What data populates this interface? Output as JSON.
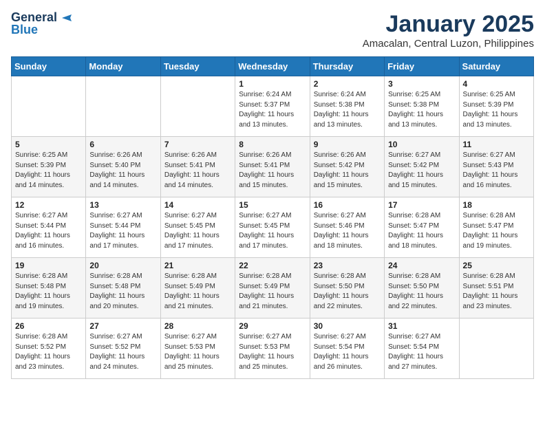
{
  "header": {
    "logo_line1": "General",
    "logo_line2": "Blue",
    "month_title": "January 2025",
    "location": "Amacalan, Central Luzon, Philippines"
  },
  "days_of_week": [
    "Sunday",
    "Monday",
    "Tuesday",
    "Wednesday",
    "Thursday",
    "Friday",
    "Saturday"
  ],
  "weeks": [
    [
      {
        "num": "",
        "info": ""
      },
      {
        "num": "",
        "info": ""
      },
      {
        "num": "",
        "info": ""
      },
      {
        "num": "1",
        "info": "Sunrise: 6:24 AM\nSunset: 5:37 PM\nDaylight: 11 hours\nand 13 minutes."
      },
      {
        "num": "2",
        "info": "Sunrise: 6:24 AM\nSunset: 5:38 PM\nDaylight: 11 hours\nand 13 minutes."
      },
      {
        "num": "3",
        "info": "Sunrise: 6:25 AM\nSunset: 5:38 PM\nDaylight: 11 hours\nand 13 minutes."
      },
      {
        "num": "4",
        "info": "Sunrise: 6:25 AM\nSunset: 5:39 PM\nDaylight: 11 hours\nand 13 minutes."
      }
    ],
    [
      {
        "num": "5",
        "info": "Sunrise: 6:25 AM\nSunset: 5:39 PM\nDaylight: 11 hours\nand 14 minutes."
      },
      {
        "num": "6",
        "info": "Sunrise: 6:26 AM\nSunset: 5:40 PM\nDaylight: 11 hours\nand 14 minutes."
      },
      {
        "num": "7",
        "info": "Sunrise: 6:26 AM\nSunset: 5:41 PM\nDaylight: 11 hours\nand 14 minutes."
      },
      {
        "num": "8",
        "info": "Sunrise: 6:26 AM\nSunset: 5:41 PM\nDaylight: 11 hours\nand 15 minutes."
      },
      {
        "num": "9",
        "info": "Sunrise: 6:26 AM\nSunset: 5:42 PM\nDaylight: 11 hours\nand 15 minutes."
      },
      {
        "num": "10",
        "info": "Sunrise: 6:27 AM\nSunset: 5:42 PM\nDaylight: 11 hours\nand 15 minutes."
      },
      {
        "num": "11",
        "info": "Sunrise: 6:27 AM\nSunset: 5:43 PM\nDaylight: 11 hours\nand 16 minutes."
      }
    ],
    [
      {
        "num": "12",
        "info": "Sunrise: 6:27 AM\nSunset: 5:44 PM\nDaylight: 11 hours\nand 16 minutes."
      },
      {
        "num": "13",
        "info": "Sunrise: 6:27 AM\nSunset: 5:44 PM\nDaylight: 11 hours\nand 17 minutes."
      },
      {
        "num": "14",
        "info": "Sunrise: 6:27 AM\nSunset: 5:45 PM\nDaylight: 11 hours\nand 17 minutes."
      },
      {
        "num": "15",
        "info": "Sunrise: 6:27 AM\nSunset: 5:45 PM\nDaylight: 11 hours\nand 17 minutes."
      },
      {
        "num": "16",
        "info": "Sunrise: 6:27 AM\nSunset: 5:46 PM\nDaylight: 11 hours\nand 18 minutes."
      },
      {
        "num": "17",
        "info": "Sunrise: 6:28 AM\nSunset: 5:47 PM\nDaylight: 11 hours\nand 18 minutes."
      },
      {
        "num": "18",
        "info": "Sunrise: 6:28 AM\nSunset: 5:47 PM\nDaylight: 11 hours\nand 19 minutes."
      }
    ],
    [
      {
        "num": "19",
        "info": "Sunrise: 6:28 AM\nSunset: 5:48 PM\nDaylight: 11 hours\nand 19 minutes."
      },
      {
        "num": "20",
        "info": "Sunrise: 6:28 AM\nSunset: 5:48 PM\nDaylight: 11 hours\nand 20 minutes."
      },
      {
        "num": "21",
        "info": "Sunrise: 6:28 AM\nSunset: 5:49 PM\nDaylight: 11 hours\nand 21 minutes."
      },
      {
        "num": "22",
        "info": "Sunrise: 6:28 AM\nSunset: 5:49 PM\nDaylight: 11 hours\nand 21 minutes."
      },
      {
        "num": "23",
        "info": "Sunrise: 6:28 AM\nSunset: 5:50 PM\nDaylight: 11 hours\nand 22 minutes."
      },
      {
        "num": "24",
        "info": "Sunrise: 6:28 AM\nSunset: 5:50 PM\nDaylight: 11 hours\nand 22 minutes."
      },
      {
        "num": "25",
        "info": "Sunrise: 6:28 AM\nSunset: 5:51 PM\nDaylight: 11 hours\nand 23 minutes."
      }
    ],
    [
      {
        "num": "26",
        "info": "Sunrise: 6:28 AM\nSunset: 5:52 PM\nDaylight: 11 hours\nand 23 minutes."
      },
      {
        "num": "27",
        "info": "Sunrise: 6:27 AM\nSunset: 5:52 PM\nDaylight: 11 hours\nand 24 minutes."
      },
      {
        "num": "28",
        "info": "Sunrise: 6:27 AM\nSunset: 5:53 PM\nDaylight: 11 hours\nand 25 minutes."
      },
      {
        "num": "29",
        "info": "Sunrise: 6:27 AM\nSunset: 5:53 PM\nDaylight: 11 hours\nand 25 minutes."
      },
      {
        "num": "30",
        "info": "Sunrise: 6:27 AM\nSunset: 5:54 PM\nDaylight: 11 hours\nand 26 minutes."
      },
      {
        "num": "31",
        "info": "Sunrise: 6:27 AM\nSunset: 5:54 PM\nDaylight: 11 hours\nand 27 minutes."
      },
      {
        "num": "",
        "info": ""
      }
    ]
  ]
}
